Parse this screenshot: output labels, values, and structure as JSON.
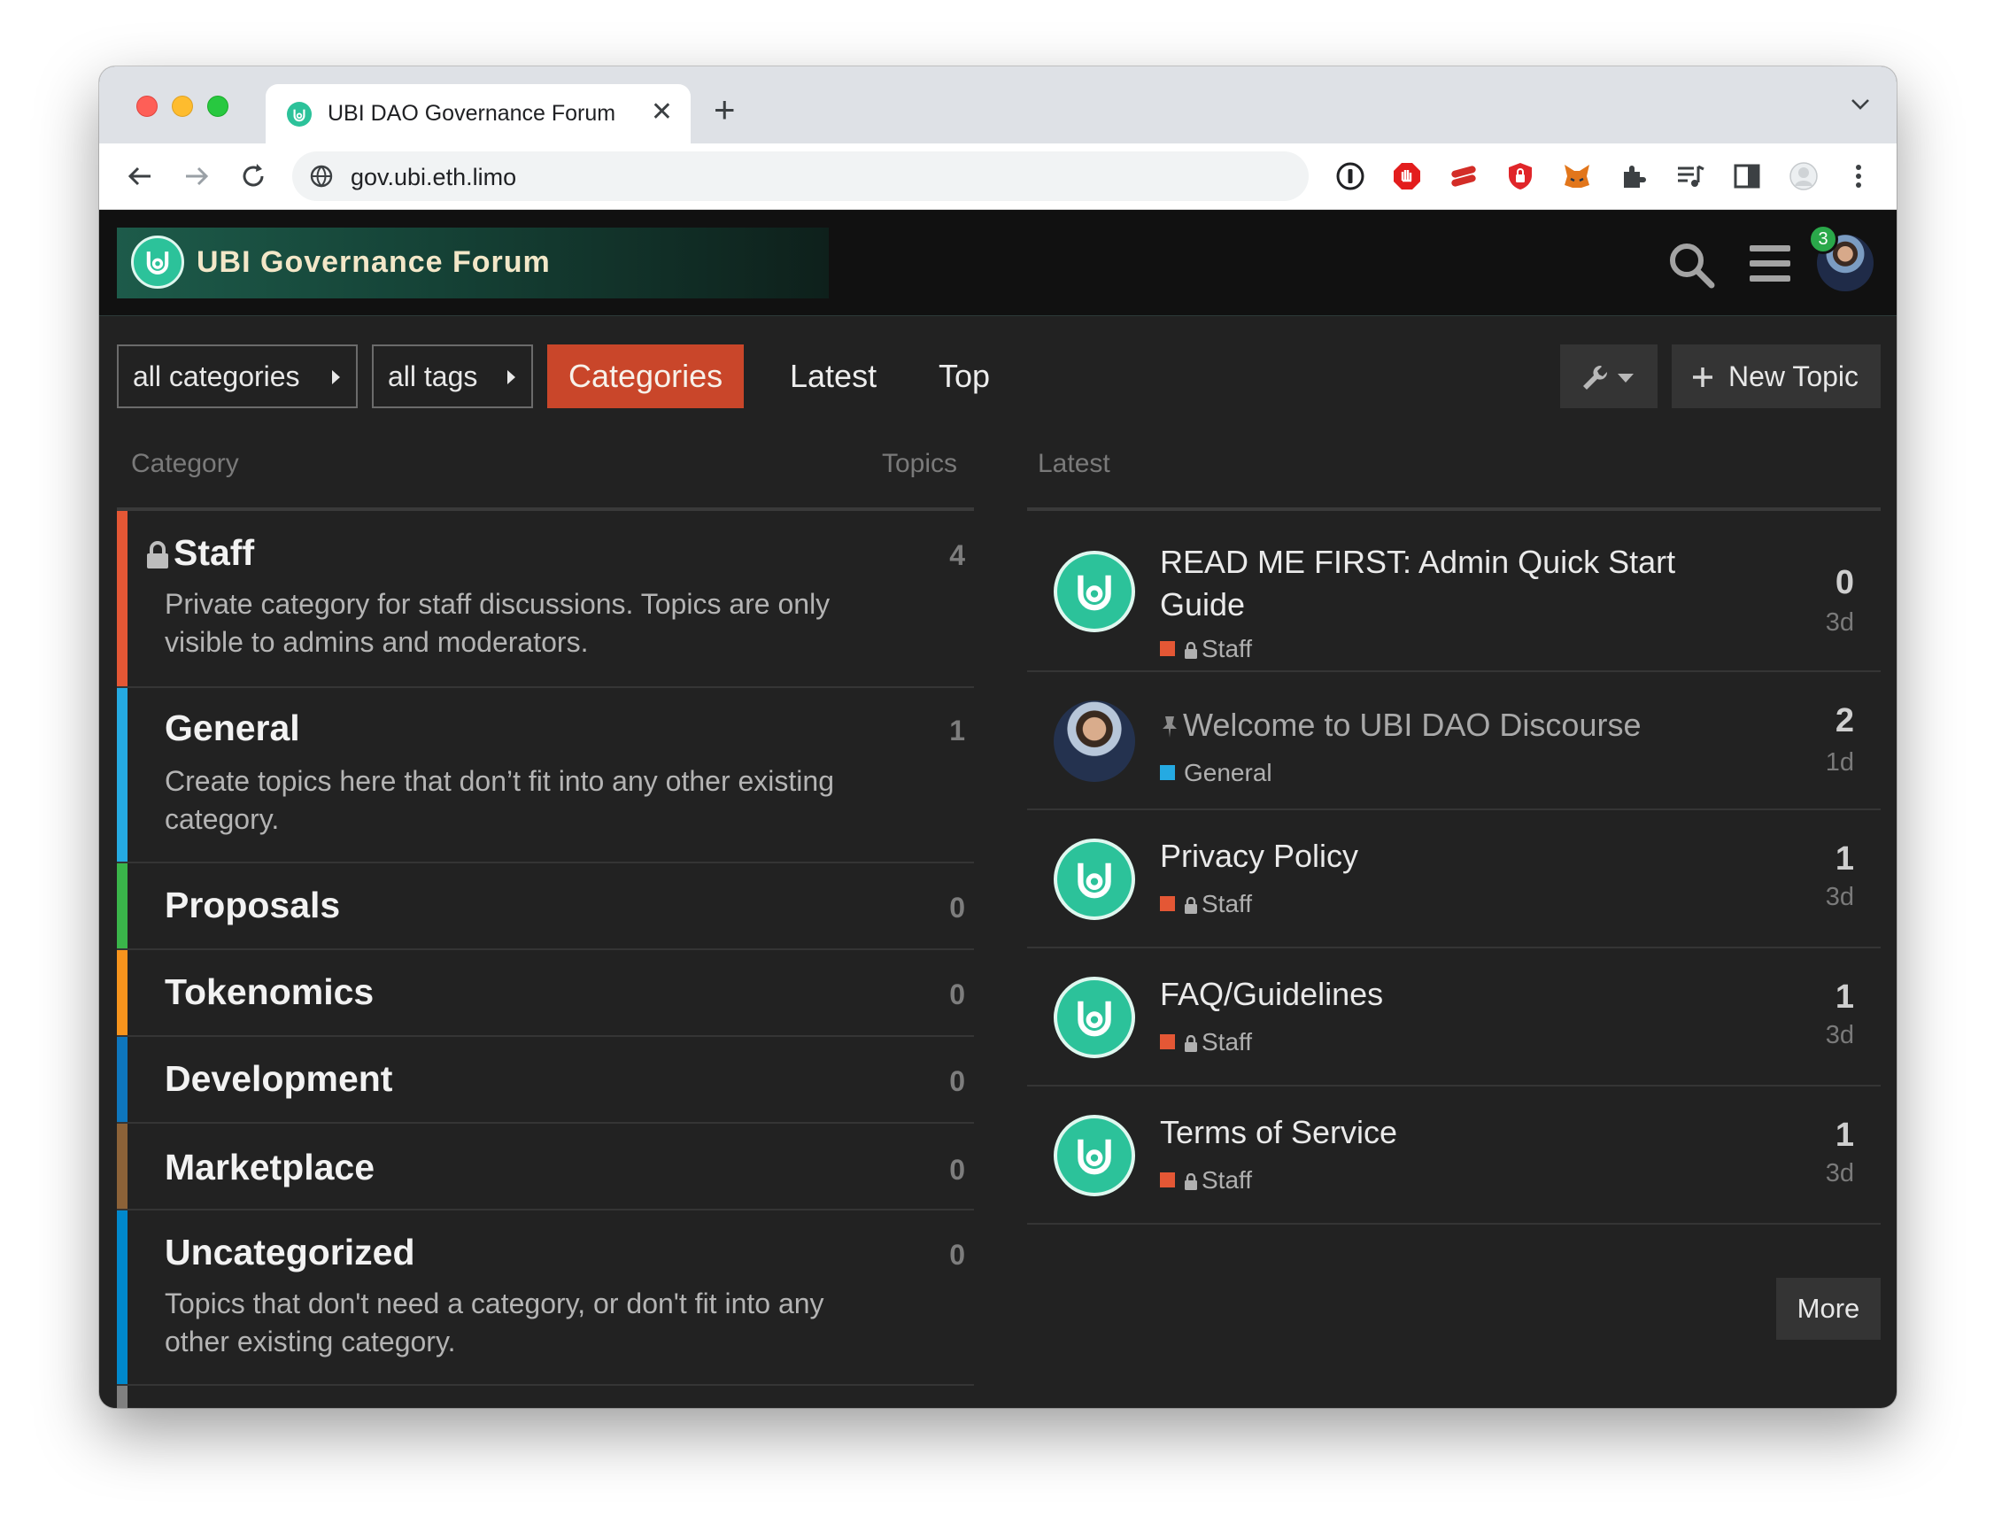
{
  "browser": {
    "tab_title": "UBI DAO Governance Forum",
    "url": "gov.ubi.eth.limo",
    "icons": [
      "back-icon",
      "forward-icon",
      "reload-icon",
      "site-info-icon",
      "1password-icon",
      "adblock-icon",
      "lastpass-icon",
      "brave-shield-icon",
      "metamask-icon",
      "extensions-icon",
      "media-icon",
      "side-panel-icon",
      "profile-icon",
      "more-icon"
    ]
  },
  "header": {
    "site_title": "UBI Governance Forum",
    "notification_count": "3"
  },
  "nav": {
    "categories_dropdown": "all categories",
    "tags_dropdown": "all tags",
    "tabs": [
      "Categories",
      "Latest",
      "Top"
    ],
    "active_tab": "Categories",
    "new_topic_label": "New Topic"
  },
  "columns": {
    "category": "Category",
    "topics": "Topics",
    "latest": "Latest"
  },
  "categories": [
    {
      "name": "Staff",
      "locked": true,
      "color": "#e45735",
      "count": "4",
      "description": "Private category for staff discussions. Topics are only visible to admins and moderators."
    },
    {
      "name": "General",
      "locked": false,
      "color": "#25aae2",
      "count": "1",
      "description": "Create topics here that don’t fit into any other existing category."
    },
    {
      "name": "Proposals",
      "locked": false,
      "color": "#3ab54a",
      "count": "0",
      "description": ""
    },
    {
      "name": "Tokenomics",
      "locked": false,
      "color": "#f7941d",
      "count": "0",
      "description": ""
    },
    {
      "name": "Development",
      "locked": false,
      "color": "#0e76bd",
      "count": "0",
      "description": ""
    },
    {
      "name": "Marketplace",
      "locked": false,
      "color": "#8c6238",
      "count": "0",
      "description": ""
    },
    {
      "name": "Uncategorized",
      "locked": false,
      "color": "#0088cc",
      "count": "0",
      "description": "Topics that don't need a category, or don't fit into any other existing category."
    }
  ],
  "topics": [
    {
      "title": "READ ME FIRST: Admin Quick Start Guide",
      "category": "Staff",
      "category_color": "#e45735",
      "locked": true,
      "replies": "0",
      "age": "3d",
      "pinned": false
    },
    {
      "title": "Welcome to UBI DAO Discourse",
      "category": "General",
      "category_color": "#25aae2",
      "locked": false,
      "replies": "2",
      "age": "1d",
      "pinned": true
    },
    {
      "title": "Privacy Policy",
      "category": "Staff",
      "category_color": "#e45735",
      "locked": true,
      "replies": "1",
      "age": "3d",
      "pinned": false
    },
    {
      "title": "FAQ/Guidelines",
      "category": "Staff",
      "category_color": "#e45735",
      "locked": true,
      "replies": "1",
      "age": "3d",
      "pinned": false
    },
    {
      "title": "Terms of Service",
      "category": "Staff",
      "category_color": "#e45735",
      "locked": true,
      "replies": "1",
      "age": "3d",
      "pinned": false
    }
  ],
  "more_label": "More",
  "colors": {
    "accent": "#c9462a",
    "brand": "#2cc29a"
  }
}
